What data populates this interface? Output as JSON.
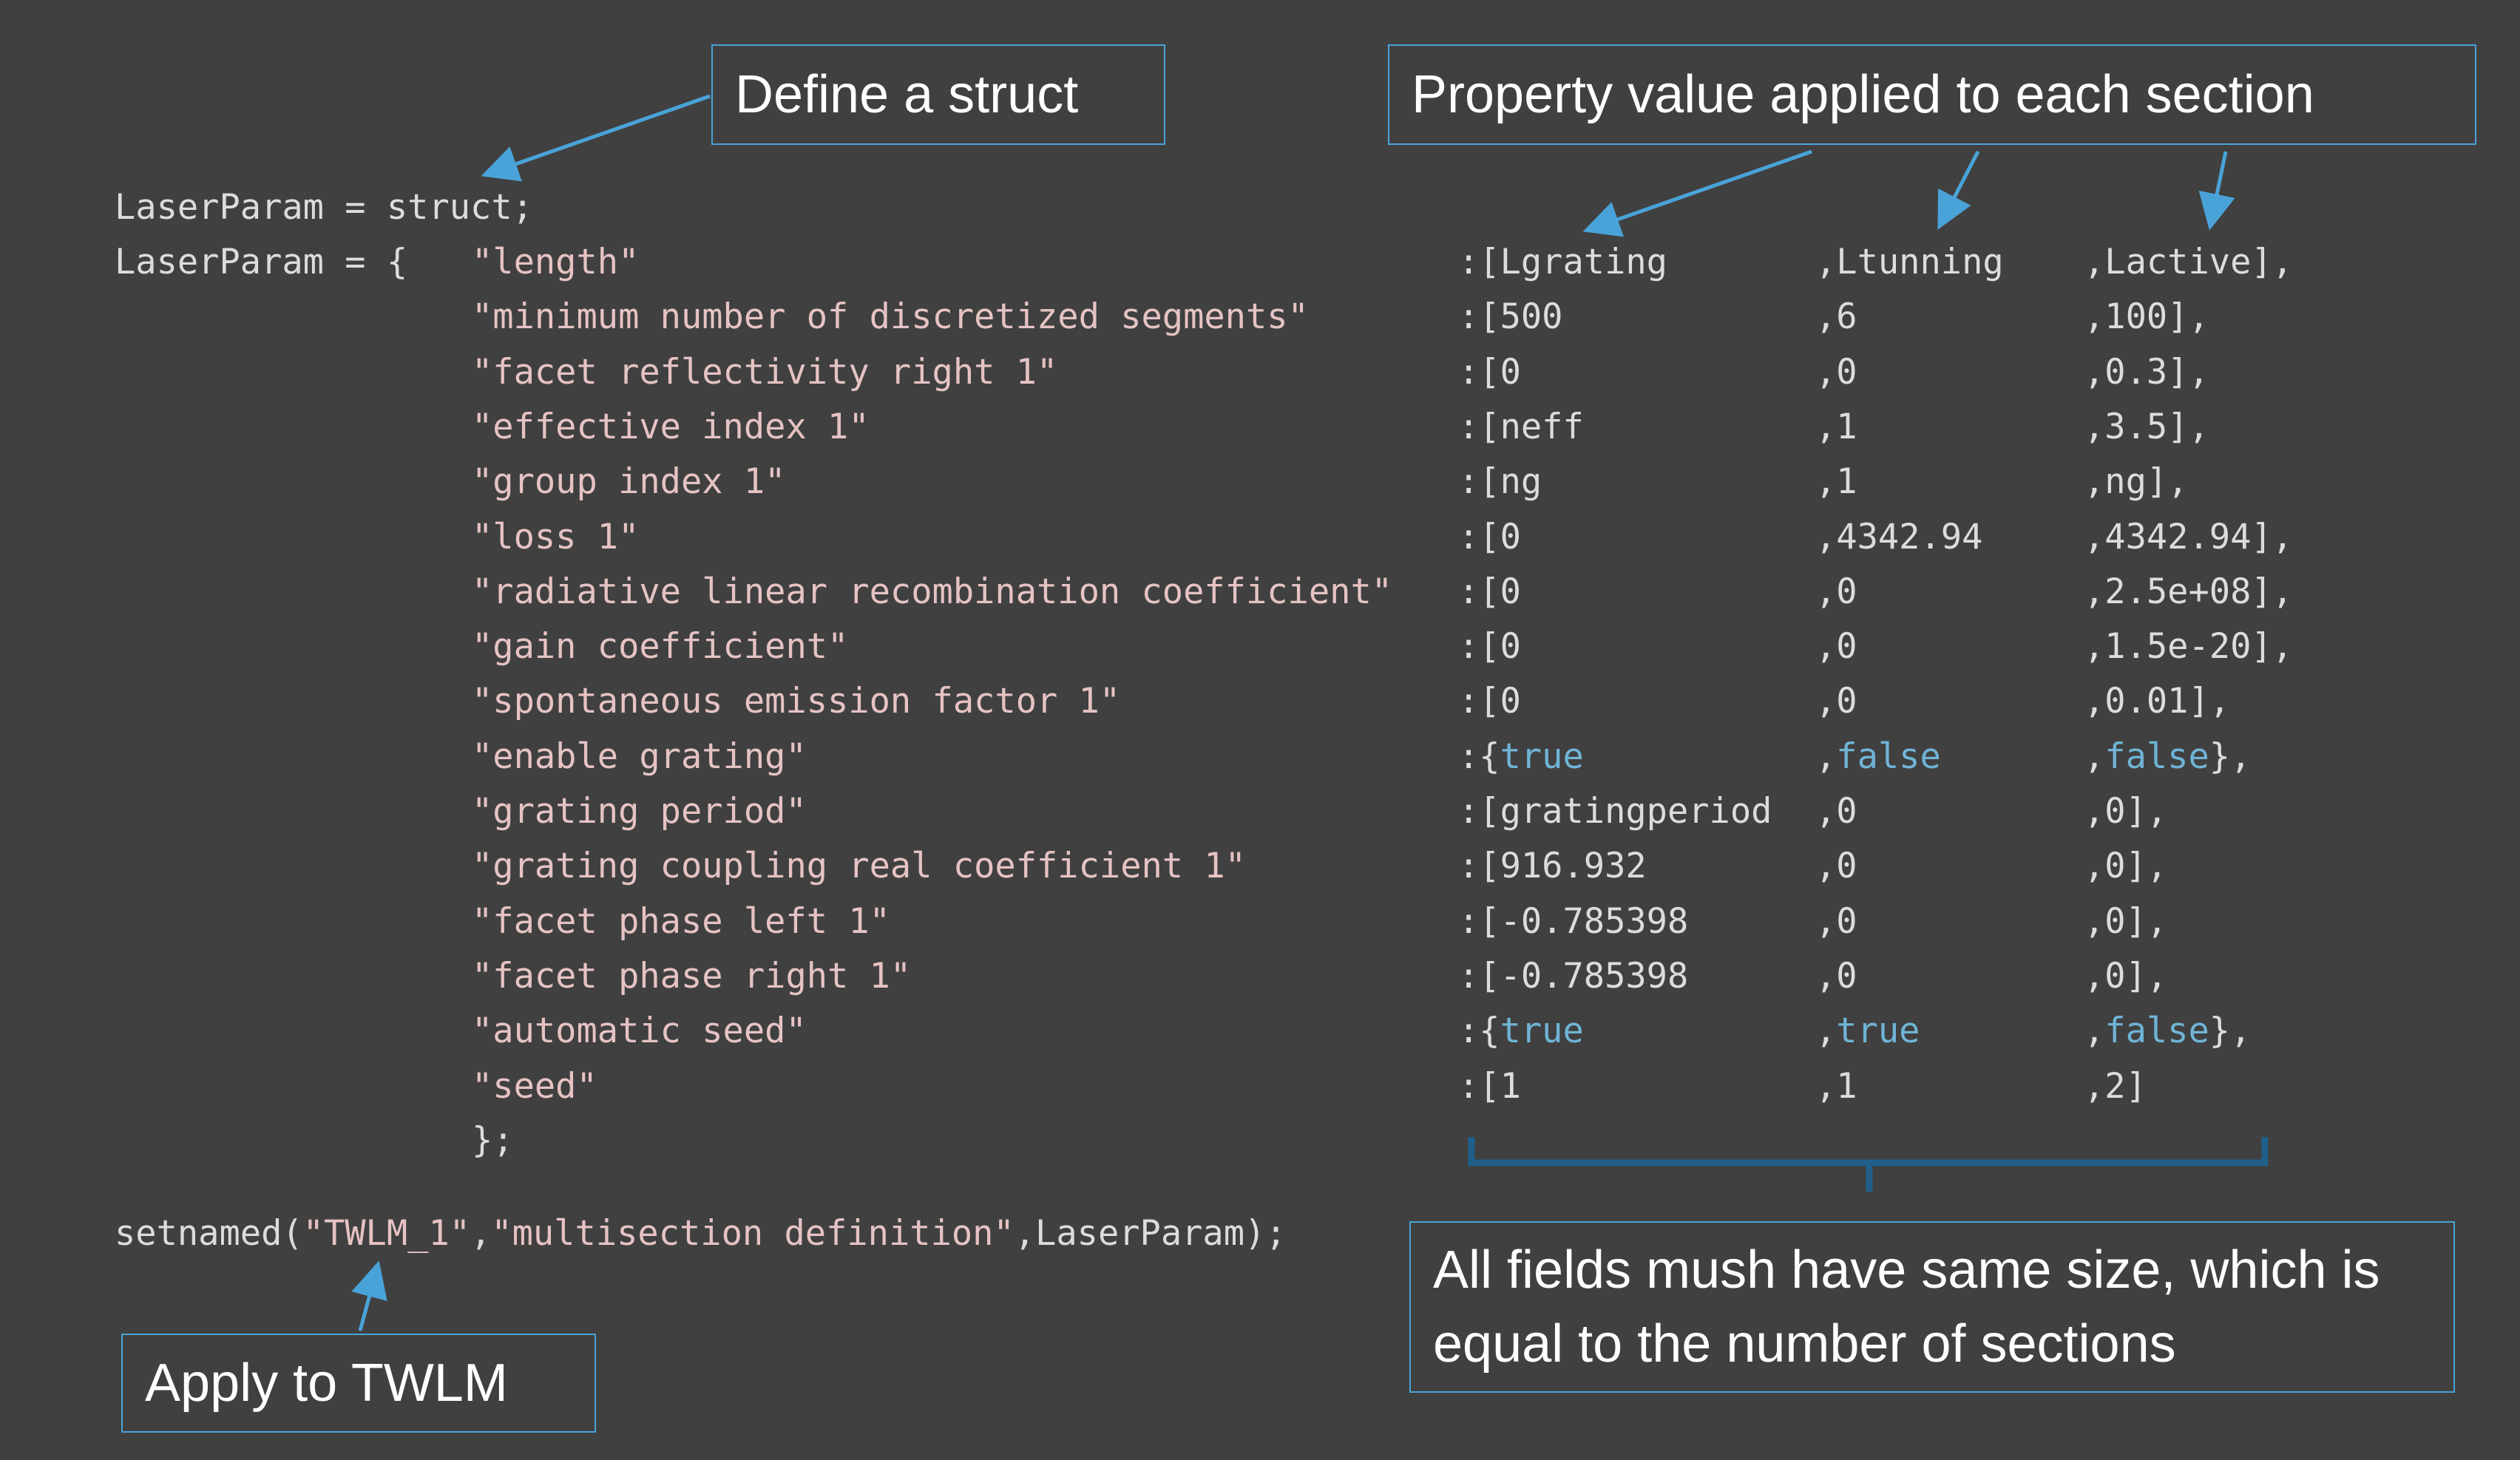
{
  "callouts": {
    "define_struct": "Define a struct",
    "property_value": "Property value applied to each section",
    "all_fields": "All fields mush have same size, which is equal to the number of sections",
    "apply_twlm": "Apply to TWLM"
  },
  "code": {
    "line1": "LaserParam = struct;",
    "line2_prefix": "LaserParam = {",
    "closing": "};",
    "setnamed_fn": "setnamed(",
    "setnamed_arg1": "\"TWLM_1\"",
    "setnamed_comma": ",",
    "setnamed_arg2": "\"multisection definition\"",
    "setnamed_tail": ",LaserParam);"
  },
  "rows": [
    {
      "key": "\"length\"",
      "v1": ":[Lgrating",
      "v2": ",Ltunning",
      "v3": ",Lactive],",
      "bool": false
    },
    {
      "key": "\"minimum number of discretized segments\"",
      "v1": ":[500",
      "v2": ",6",
      "v3": ",100],",
      "bool": false
    },
    {
      "key": "\"facet reflectivity right 1\"",
      "v1": ":[0",
      "v2": ",0",
      "v3": ",0.3],",
      "bool": false
    },
    {
      "key": "\"effective index 1\"",
      "v1": ":[neff",
      "v2": ",1",
      "v3": ",3.5],",
      "bool": false
    },
    {
      "key": "\"group index 1\"",
      "v1": ":[ng",
      "v2": ",1",
      "v3": ",ng],",
      "bool": false
    },
    {
      "key": "\"loss 1\"",
      "v1": ":[0",
      "v2": ",4342.94",
      "v3": ",4342.94],",
      "bool": false
    },
    {
      "key": "\"radiative linear recombination coefficient\"",
      "v1": ":[0",
      "v2": ",0",
      "v3": ",2.5e+08],",
      "bool": false
    },
    {
      "key": "\"gain coefficient\"",
      "v1": ":[0",
      "v2": ",0",
      "v3": ",1.5e-20],",
      "bool": false
    },
    {
      "key": "\"spontaneous emission factor 1\"",
      "v1": ":[0",
      "v2": ",0",
      "v3": ",0.01],",
      "bool": false
    },
    {
      "key": "\"enable grating\"",
      "v1": ":{true",
      "v2": ",false",
      "v3": ",false},",
      "bool": true
    },
    {
      "key": "\"grating period\"",
      "v1": ":[gratingperiod",
      "v2": ",0",
      "v3": ",0],",
      "bool": false
    },
    {
      "key": "\"grating coupling real coefficient 1\"",
      "v1": ":[916.932",
      "v2": ",0",
      "v3": ",0],",
      "bool": false
    },
    {
      "key": "\"facet phase left 1\"",
      "v1": ":[-0.785398",
      "v2": ",0",
      "v3": ",0],",
      "bool": false
    },
    {
      "key": "\"facet phase right 1\"",
      "v1": ":[-0.785398",
      "v2": ",0",
      "v3": ",0],",
      "bool": false
    },
    {
      "key": "\"automatic seed\"",
      "v1": ":{true",
      "v2": ",true",
      "v3": ",false},",
      "bool": true
    },
    {
      "key": "\"seed\"",
      "v1": ":[1",
      "v2": ",1",
      "v3": ",2]",
      "bool": false
    }
  ],
  "colors": {
    "background": "#404040",
    "accent": "#4aa3d8",
    "string": "#e6c3c3",
    "boolean": "#6fb4d6",
    "brace": "#1f5f8a"
  }
}
